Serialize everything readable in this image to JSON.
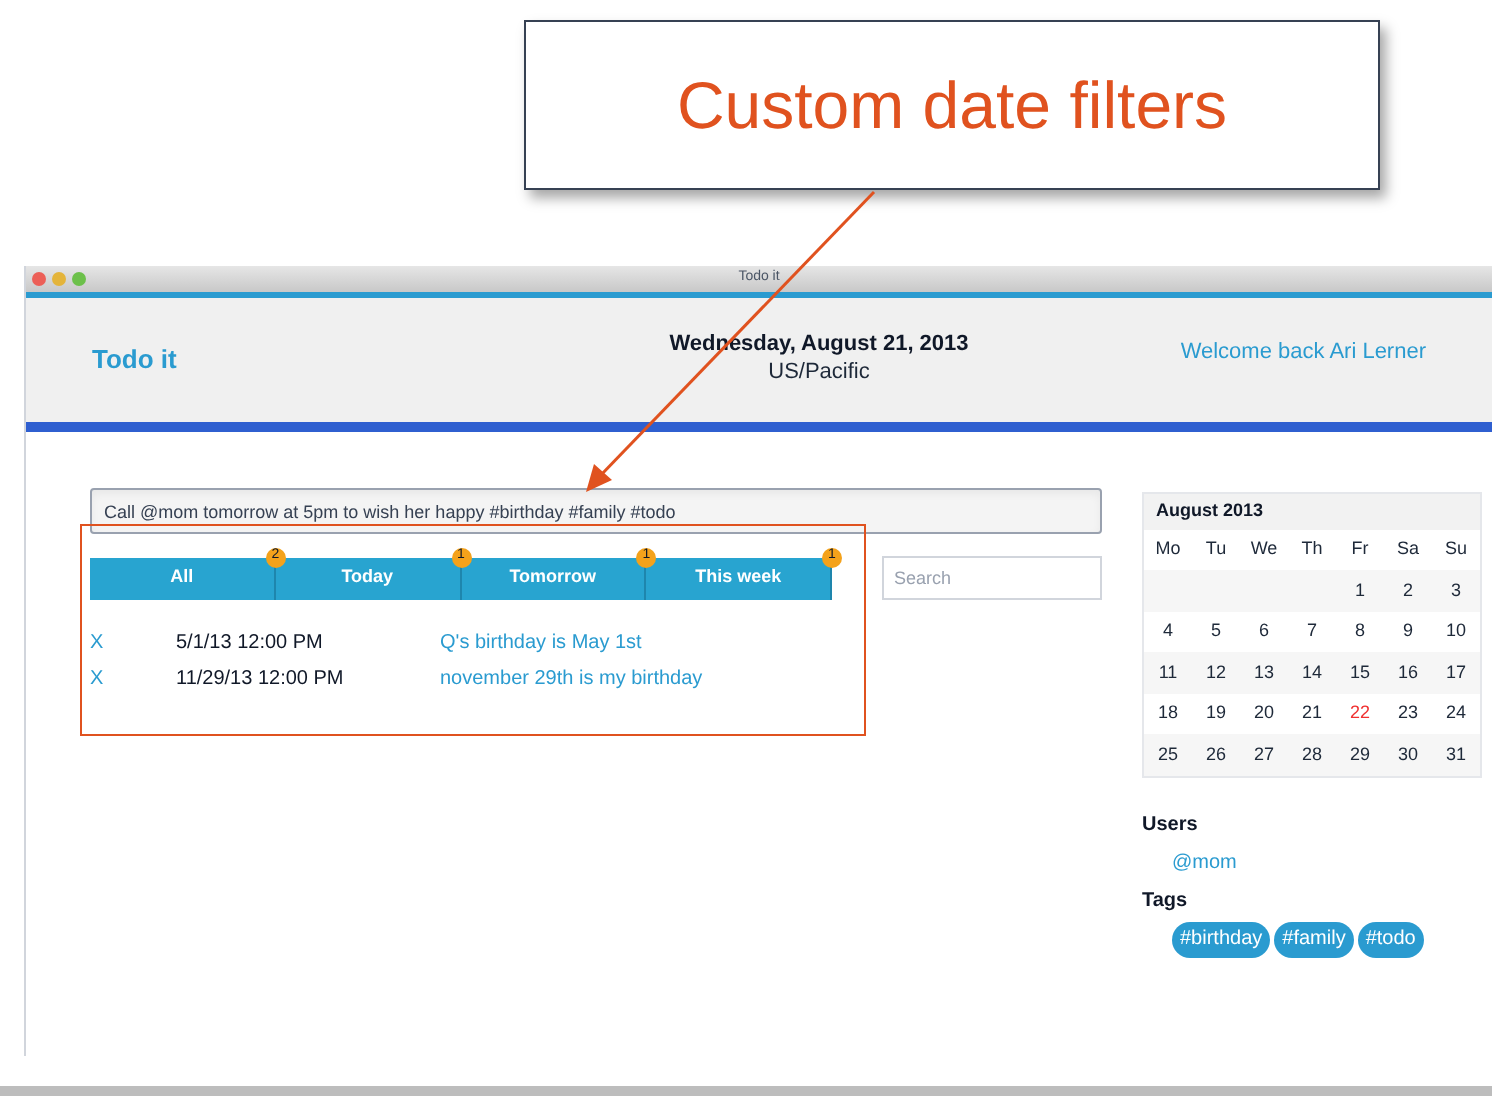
{
  "callout": {
    "text": "Custom date filters"
  },
  "window": {
    "title": "Todo it"
  },
  "header": {
    "brand": "Todo it",
    "date": "Wednesday, August 21, 2013",
    "timezone": "US/Pacific",
    "welcome": "Welcome back Ari Lerner"
  },
  "new_todo": {
    "value": "Call @mom tomorrow at 5pm to wish her happy #birthday #family #todo"
  },
  "filters": [
    {
      "label": "All",
      "badge": "2"
    },
    {
      "label": "Today",
      "badge": "1"
    },
    {
      "label": "Tomorrow",
      "badge": "1"
    },
    {
      "label": "This week",
      "badge": "1"
    }
  ],
  "search": {
    "placeholder": "Search"
  },
  "todos": [
    {
      "delete": "X",
      "date": "5/1/13 12:00 PM",
      "text": "Q's birthday is May 1st"
    },
    {
      "delete": "X",
      "date": "11/29/13 12:00 PM",
      "text": "november 29th is my birthday"
    }
  ],
  "calendar": {
    "title": "August 2013",
    "weekdays": [
      "Mo",
      "Tu",
      "We",
      "Th",
      "Fr",
      "Sa",
      "Su"
    ],
    "weeks": [
      [
        {
          "day": "1",
          "today": false
        },
        {
          "day": "2",
          "today": false
        },
        {
          "day": "3",
          "today": false
        }
      ],
      [
        {
          "day": "4",
          "today": false
        },
        {
          "day": "5",
          "today": false
        },
        {
          "day": "6",
          "today": false
        },
        {
          "day": "7",
          "today": false
        },
        {
          "day": "8",
          "today": false
        },
        {
          "day": "9",
          "today": false
        },
        {
          "day": "10",
          "today": false
        }
      ],
      [
        {
          "day": "11",
          "today": false
        },
        {
          "day": "12",
          "today": false
        },
        {
          "day": "13",
          "today": false
        },
        {
          "day": "14",
          "today": false
        },
        {
          "day": "15",
          "today": false
        },
        {
          "day": "16",
          "today": false
        },
        {
          "day": "17",
          "today": false
        }
      ],
      [
        {
          "day": "18",
          "today": false
        },
        {
          "day": "19",
          "today": false
        },
        {
          "day": "20",
          "today": false
        },
        {
          "day": "21",
          "today": false
        },
        {
          "day": "22",
          "today": true
        },
        {
          "day": "23",
          "today": false
        },
        {
          "day": "24",
          "today": false
        }
      ],
      [
        {
          "day": "25",
          "today": false
        },
        {
          "day": "26",
          "today": false
        },
        {
          "day": "27",
          "today": false
        },
        {
          "day": "28",
          "today": false
        },
        {
          "day": "29",
          "today": false
        },
        {
          "day": "30",
          "today": false
        },
        {
          "day": "31",
          "today": false
        }
      ]
    ]
  },
  "users": {
    "heading": "Users",
    "items": [
      "@mom"
    ]
  },
  "tags": {
    "heading": "Tags",
    "items": [
      "#birthday",
      "#family",
      "#todo"
    ]
  }
}
